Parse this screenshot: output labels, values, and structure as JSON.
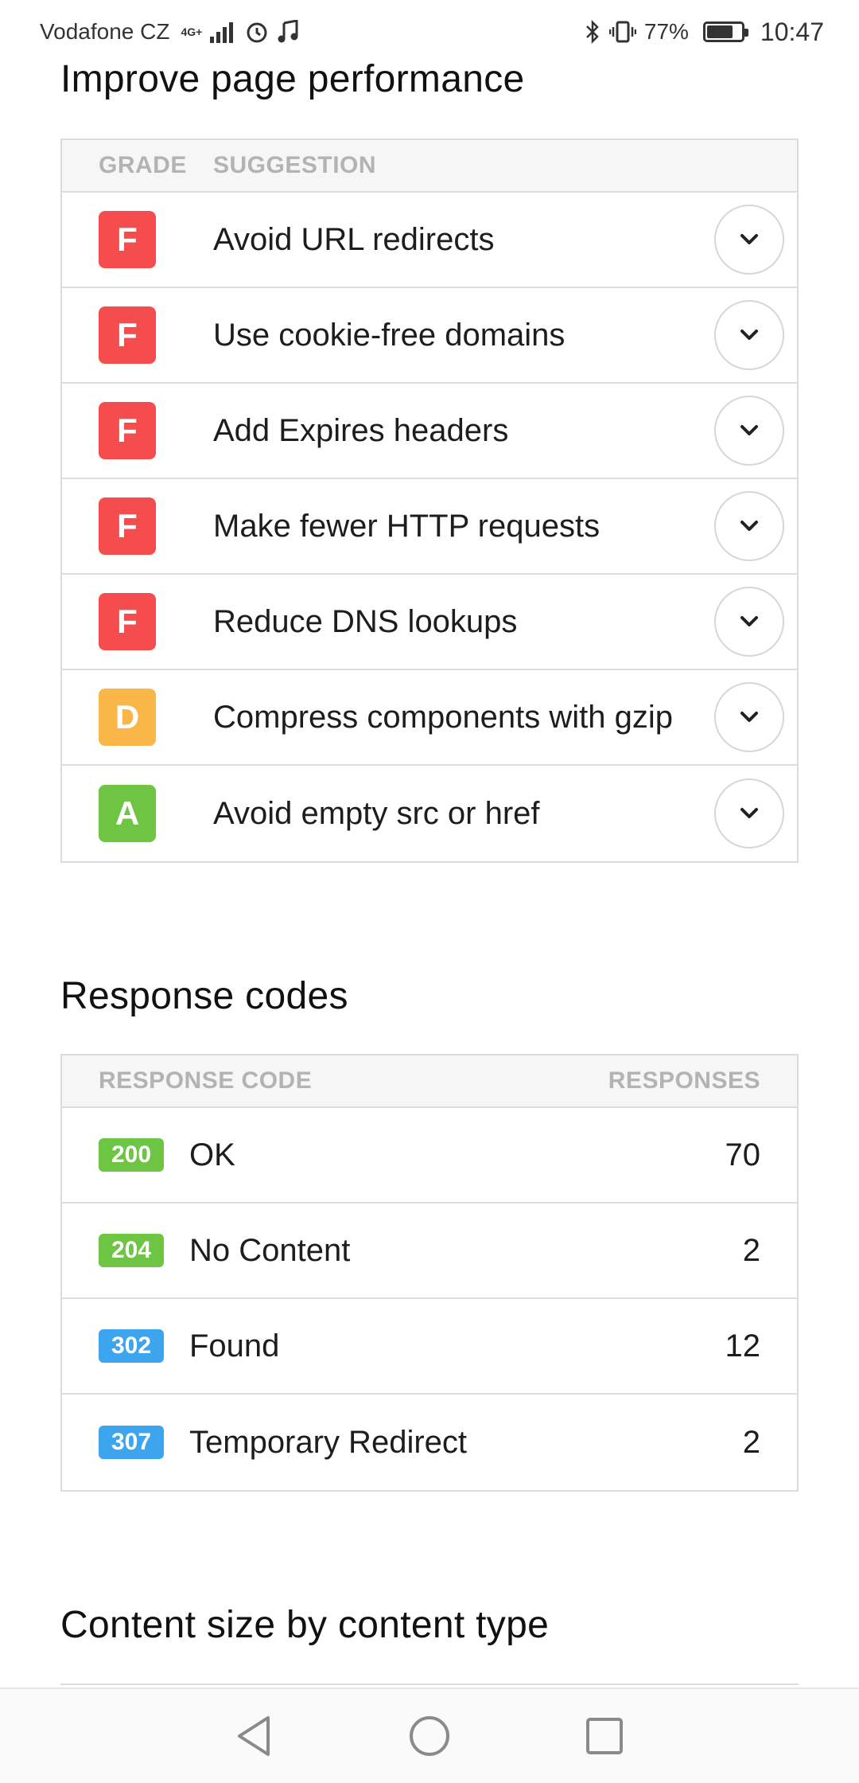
{
  "status_bar": {
    "carrier": "Vodafone CZ",
    "network": "4G+",
    "battery_percent_text": "77%",
    "battery_level": 0.77,
    "time": "10:47"
  },
  "performance": {
    "title": "Improve page performance",
    "col_grade": "GRADE",
    "col_suggestion": "SUGGESTION",
    "rows": [
      {
        "grade": "F",
        "color": "#f54d4d",
        "text": "Avoid URL redirects"
      },
      {
        "grade": "F",
        "color": "#f54d4d",
        "text": "Use cookie-free domains"
      },
      {
        "grade": "F",
        "color": "#f54d4d",
        "text": "Add Expires headers"
      },
      {
        "grade": "F",
        "color": "#f54d4d",
        "text": "Make fewer HTTP requests"
      },
      {
        "grade": "F",
        "color": "#f54d4d",
        "text": "Reduce DNS lookups"
      },
      {
        "grade": "D",
        "color": "#fbb64a",
        "text": "Compress components with gzip"
      },
      {
        "grade": "A",
        "color": "#6ec443",
        "text": "Avoid empty src or href"
      }
    ]
  },
  "responses": {
    "title": "Response codes",
    "col_code": "RESPONSE CODE",
    "col_responses": "RESPONSES",
    "rows": [
      {
        "code": "200",
        "color": "#6ec443",
        "label": "OK",
        "count": "70"
      },
      {
        "code": "204",
        "color": "#6ec443",
        "label": "No Content",
        "count": "2"
      },
      {
        "code": "302",
        "color": "#3da5ee",
        "label": "Found",
        "count": "12"
      },
      {
        "code": "307",
        "color": "#3da5ee",
        "label": "Temporary Redirect",
        "count": "2"
      }
    ]
  },
  "content_size": {
    "title": "Content size by content type"
  },
  "icons": {
    "expand": "chevron-down-icon",
    "back": "back-triangle-icon",
    "home": "home-circle-icon",
    "recents": "recents-square-icon"
  }
}
